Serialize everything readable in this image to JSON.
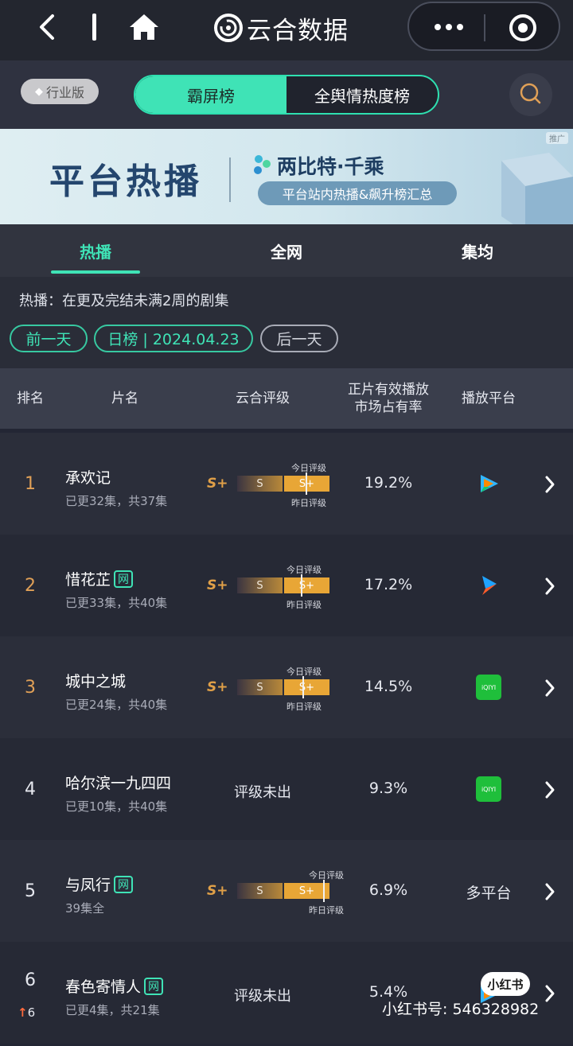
{
  "nav": {
    "brand": "云合数据"
  },
  "header": {
    "badge": "行业版",
    "seg_tabs": [
      "霸屏榜",
      "全舆情热度榜"
    ]
  },
  "banner": {
    "ad_tag": "推广",
    "title": "平台热播",
    "brand": "两比特·千乘",
    "pill": "平台站内热播&飙升榜汇总"
  },
  "tabs": [
    "热播",
    "全网",
    "集均"
  ],
  "filters": {
    "desc": "热播：在更及完结未满2周的剧集",
    "prev": "前一天",
    "date": "日榜 | 2024.04.23",
    "next": "后一天"
  },
  "columns": {
    "rank": "排名",
    "title": "片名",
    "rating": "云合评级",
    "share": "正片有效播放\n市场占有率",
    "platform": "播放平台"
  },
  "labels": {
    "today": "今日评级",
    "yesterday": "昨日评级",
    "no_rating": "评级未出"
  },
  "rows": [
    {
      "rank": "1",
      "title": "承欢记",
      "net": "",
      "eps": "已更32集，共37集",
      "rating": "S+",
      "yesterday": "S",
      "today": "S+",
      "share": "19.2%",
      "platform": "tencent-video-icon",
      "platform_text": ""
    },
    {
      "rank": "2",
      "title": "惜花芷",
      "net": "网",
      "eps": "已更33集，共40集",
      "rating": "S+",
      "yesterday": "S",
      "today": "S+",
      "share": "17.2%",
      "platform": "youku-icon",
      "platform_text": ""
    },
    {
      "rank": "3",
      "title": "城中之城",
      "net": "",
      "eps": "已更24集，共40集",
      "rating": "S+",
      "yesterday": "S",
      "today": "S+",
      "share": "14.5%",
      "platform": "iqiyi-icon",
      "platform_text": ""
    },
    {
      "rank": "4",
      "title": "哈尔滨一九四四",
      "net": "",
      "eps": "已更10集，共40集",
      "rating": "",
      "yesterday": "",
      "today": "",
      "share": "9.3%",
      "platform": "iqiyi-icon",
      "platform_text": ""
    },
    {
      "rank": "5",
      "title": "与凤行",
      "net": "网",
      "eps": "39集全",
      "rating": "S+",
      "yesterday": "S",
      "today": "S+",
      "share": "6.9%",
      "platform": "",
      "platform_text": "多平台"
    },
    {
      "rank": "6",
      "title": "春色寄情人",
      "net": "网",
      "eps": "已更4集，共21集",
      "rating": "",
      "yesterday": "",
      "today": "",
      "share": "5.4%",
      "platform": "tencent-video-icon",
      "platform_text": "",
      "change": "6"
    }
  ],
  "iqiyi_label": "iQIYI",
  "watermark": "小红书号: 546328982",
  "xhs_logo": "小红书",
  "colors": {
    "accent": "#3fe3b6",
    "rank_top": "#e0a057",
    "rating_gold": "#e8a636",
    "rise": "#ff6a3d"
  }
}
